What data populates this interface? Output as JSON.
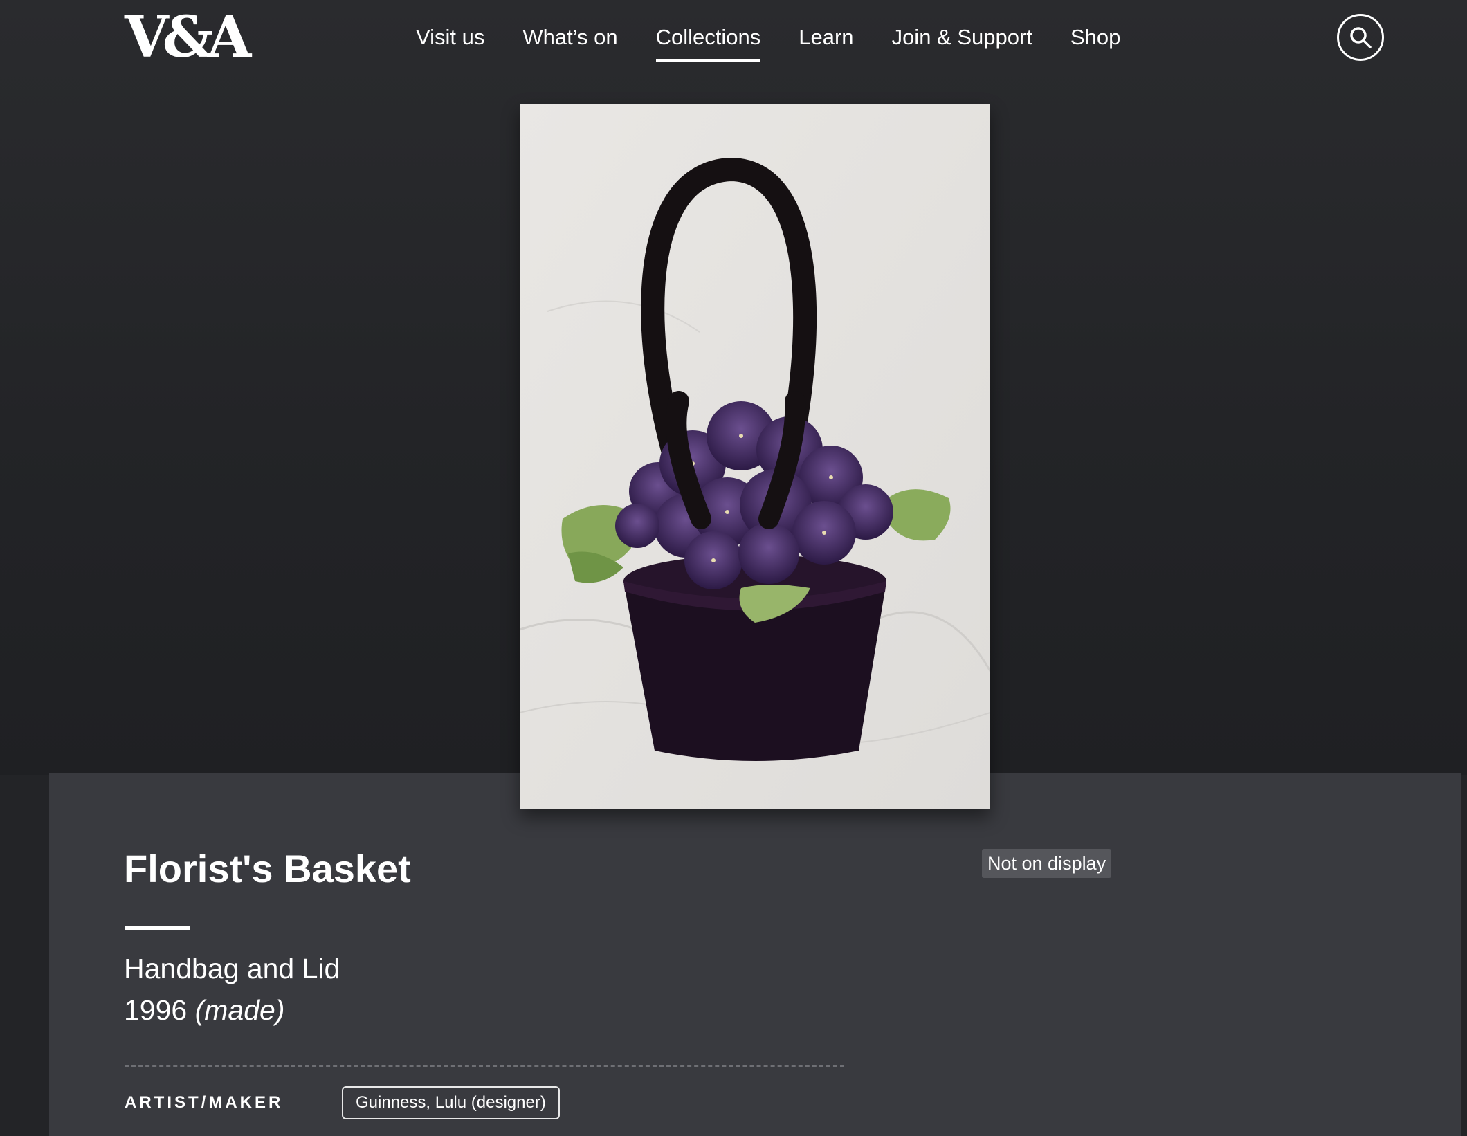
{
  "header": {
    "logo_text": "V&A",
    "nav": [
      {
        "label": "Visit us",
        "active": false
      },
      {
        "label": "What’s on",
        "active": false
      },
      {
        "label": "Collections",
        "active": true
      },
      {
        "label": "Learn",
        "active": false
      },
      {
        "label": "Join & Support",
        "active": false
      },
      {
        "label": "Shop",
        "active": false
      }
    ],
    "search_icon": "search-icon"
  },
  "object": {
    "title": "Florist's Basket",
    "type": "Handbag and Lid",
    "date": "1996",
    "date_qualifier": "(made)",
    "status": "Not on display"
  },
  "details": {
    "artist_label": "ARTIST/MAKER",
    "artist_value": "Guinness, Lulu (designer)"
  },
  "colors": {
    "page_bg": "#232427",
    "panel_bg": "#393a3f",
    "badge_bg": "#55565b",
    "accent": "#ffffff"
  }
}
